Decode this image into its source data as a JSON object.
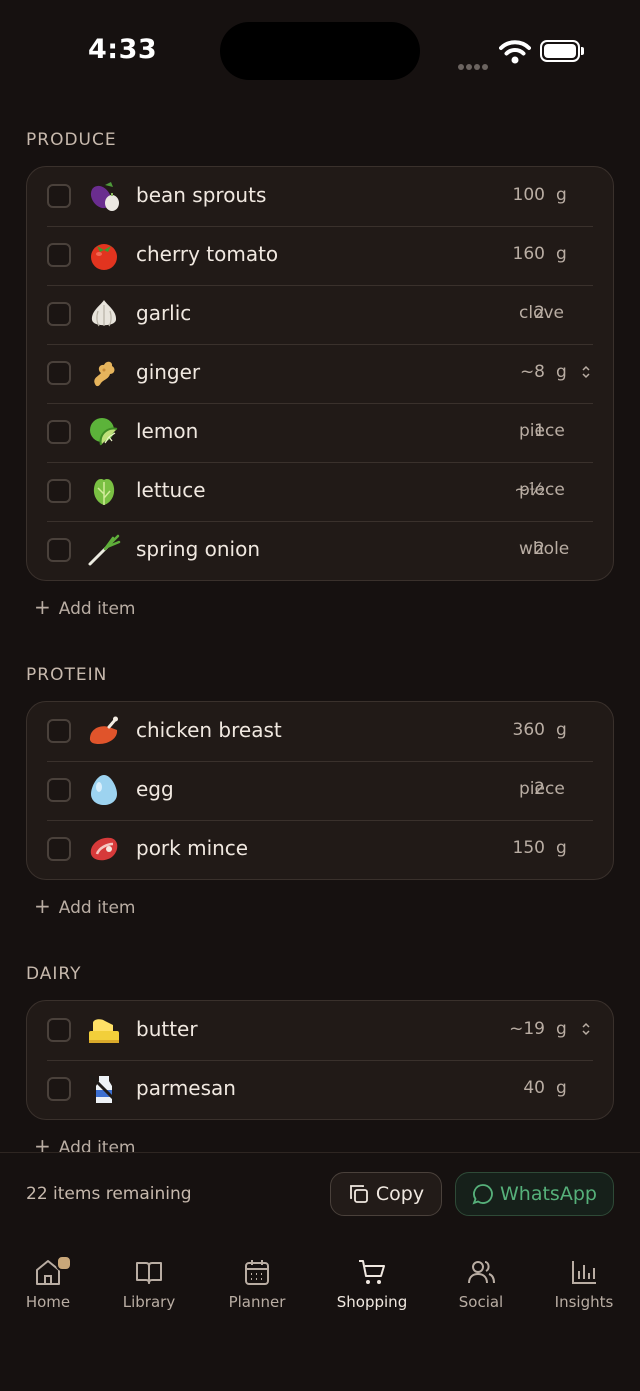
{
  "status_bar": {
    "time": "4:33"
  },
  "sections": [
    {
      "title": "PRODUCE",
      "items": [
        {
          "name": "bean sprouts",
          "qty": "100",
          "unit": "g",
          "icon": "eggplant-garlic-icon"
        },
        {
          "name": "cherry tomato",
          "qty": "160",
          "unit": "g",
          "icon": "tomato-icon"
        },
        {
          "name": "garlic",
          "qty": "2",
          "unit": "clove",
          "icon": "garlic-icon"
        },
        {
          "name": "ginger",
          "qty": "~8",
          "unit": "g",
          "icon": "ginger-icon",
          "stepper": true
        },
        {
          "name": "lemon",
          "qty": "1",
          "unit": "piece",
          "icon": "lime-icon"
        },
        {
          "name": "lettuce",
          "qty": "~½",
          "unit": "piece",
          "icon": "lettuce-icon"
        },
        {
          "name": "spring onion",
          "qty": "2",
          "unit": "whole",
          "icon": "spring-onion-icon"
        }
      ],
      "add_label": "Add item"
    },
    {
      "title": "PROTEIN",
      "items": [
        {
          "name": "chicken breast",
          "qty": "360",
          "unit": "g",
          "icon": "poultry-leg-icon"
        },
        {
          "name": "egg",
          "qty": "2",
          "unit": "piece",
          "icon": "egg-icon"
        },
        {
          "name": "pork mince",
          "qty": "150",
          "unit": "g",
          "icon": "meat-icon"
        }
      ],
      "add_label": "Add item"
    },
    {
      "title": "DAIRY",
      "items": [
        {
          "name": "butter",
          "qty": "~19",
          "unit": "g",
          "icon": "butter-icon",
          "stepper": true
        },
        {
          "name": "parmesan",
          "qty": "40",
          "unit": "g",
          "icon": "no-milk-icon"
        }
      ],
      "add_label": "Add item"
    }
  ],
  "footer": {
    "remaining": "22 items remaining",
    "copy_label": "Copy",
    "whatsapp_label": "WhatsApp"
  },
  "tabs": [
    {
      "label": "Home",
      "icon": "home-icon"
    },
    {
      "label": "Library",
      "icon": "book-icon"
    },
    {
      "label": "Planner",
      "icon": "calendar-icon"
    },
    {
      "label": "Shopping",
      "icon": "cart-icon",
      "active": true
    },
    {
      "label": "Social",
      "icon": "users-icon"
    },
    {
      "label": "Insights",
      "icon": "bar-chart-icon"
    }
  ],
  "colors": {
    "background": "#161110",
    "card": "#211a17",
    "accent_green": "#56b07a",
    "badge": "#c9a779"
  }
}
